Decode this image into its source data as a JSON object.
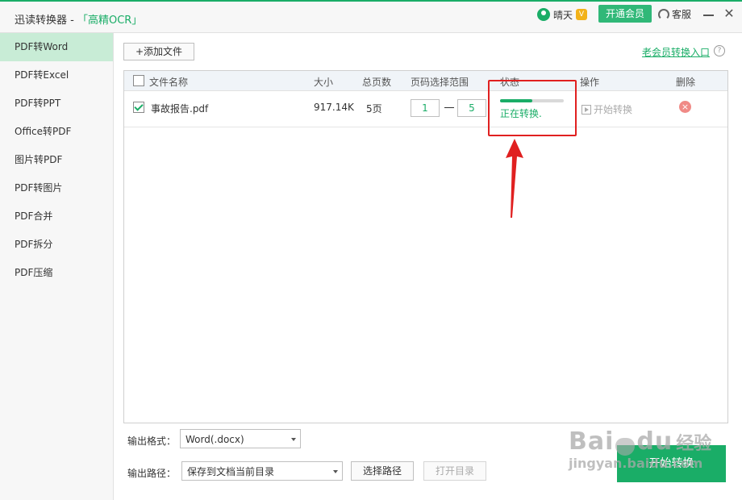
{
  "titlebar": {
    "app_title": "迅读转换器 - ",
    "app_subtitle": "「高精OCR」",
    "username": "晴天",
    "vip_badge": "V",
    "vip_button": "开通会员",
    "service": "客服",
    "close": "✕"
  },
  "sidebar": {
    "items": [
      {
        "label": "PDF转Word",
        "active": true
      },
      {
        "label": "PDF转Excel"
      },
      {
        "label": "PDF转PPT"
      },
      {
        "label": "Office转PDF"
      },
      {
        "label": "图片转PDF"
      },
      {
        "label": "PDF转图片"
      },
      {
        "label": "PDF合并"
      },
      {
        "label": "PDF拆分"
      },
      {
        "label": "PDF压缩"
      }
    ]
  },
  "toolbar": {
    "add_file": "+添加文件",
    "old_member": "老会员转换入口",
    "help": "?"
  },
  "table": {
    "headers": {
      "name": "文件名称",
      "size": "大小",
      "pages": "总页数",
      "range": "页码选择范围",
      "status": "状态",
      "action": "操作",
      "delete": "删除"
    },
    "rows": [
      {
        "name": "事故报告.pdf",
        "size": "917.14K",
        "pages": "5页",
        "from": "1",
        "to": "5",
        "progress": 0.5,
        "status": "正在转换.",
        "action": "开始转换",
        "delete": "×"
      }
    ]
  },
  "output": {
    "format_label": "输出格式：",
    "format_value": "Word(.docx)",
    "path_label": "输出路径：",
    "path_value": "保存到文档当前目录",
    "choose_path": "选择路径",
    "open_dir": "打开目录",
    "start": "开始转换"
  },
  "watermark": {
    "main": "Bai",
    "main2": "du",
    "cn": "经验",
    "url": "jingyan.baidu.com"
  },
  "colors": {
    "accent": "#1aad67",
    "highlight": "#e02020"
  }
}
